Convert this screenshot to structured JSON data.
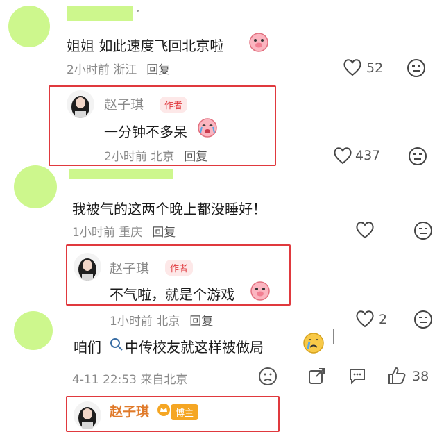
{
  "comment1": {
    "text": "姐姐 如此速度飞回北京啦",
    "time_location": "2小时前 浙江",
    "reply_label": "回复",
    "like_count": "52"
  },
  "reply1": {
    "author": "赵子琪",
    "tag": "作者",
    "text": "一分钟不多呆",
    "time_location": "2小时前 北京",
    "reply_label": "回复",
    "like_count": "437"
  },
  "comment2": {
    "text": "我被气的这两个晚上都没睡好！",
    "time_location": "1小时前 重庆",
    "reply_label": "回复"
  },
  "reply2": {
    "author": "赵子琪",
    "tag": "作者",
    "text": "不气啦，就是个游戏"
  },
  "comment3": {
    "time_location": "1小时前 北京",
    "reply_label": "回复",
    "like_count": "2",
    "text_prefix": "咱们",
    "text_rest": "中传校友就这样被做局"
  },
  "post_footer": {
    "datetime_location": "4-11 22:53 来自北京",
    "like_count": "38"
  },
  "bottom_reply": {
    "author": "赵子琪",
    "tag": "博主"
  }
}
